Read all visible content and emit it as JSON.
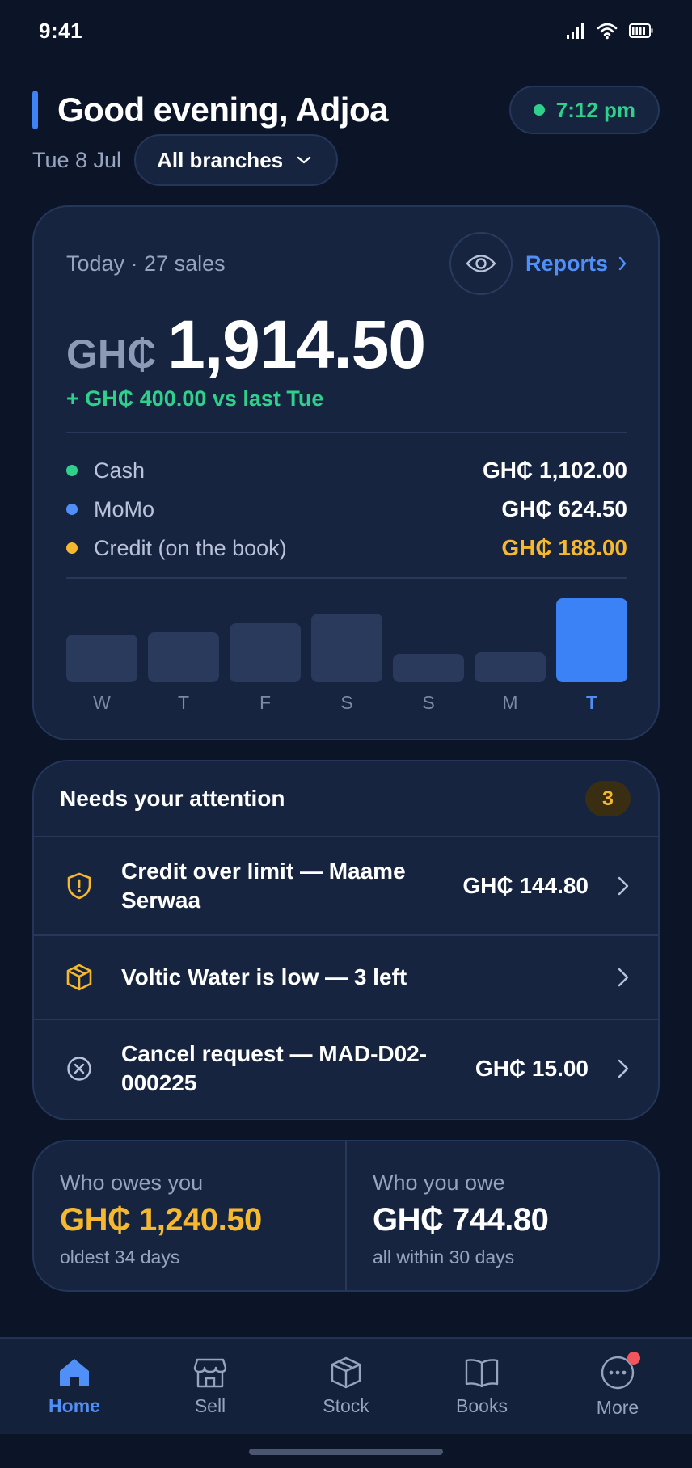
{
  "status_bar": {
    "time": "9:41"
  },
  "header": {
    "greeting": "Good evening, Adjoa",
    "time_pill": "7:12 pm",
    "date": "Tue 8 Jul",
    "branch_select": "All branches"
  },
  "sales": {
    "meta": "Today · 27 sales",
    "reports_label": "Reports",
    "currency": "GH₵",
    "amount": "1,914.50",
    "delta": "+ GH₵ 400.00 vs last Tue",
    "breakdown": [
      {
        "label": "Cash",
        "value": "GH₵ 1,102.00",
        "color": "#2fd08b"
      },
      {
        "label": "MoMo",
        "value": "GH₵ 624.50",
        "color": "#4f8ff7"
      },
      {
        "label": "Credit (on the book)",
        "value": "GH₵ 188.00",
        "color": "#f5b82e"
      }
    ]
  },
  "chart_data": {
    "type": "bar",
    "categories": [
      "W",
      "T",
      "F",
      "S",
      "S",
      "M",
      "T"
    ],
    "values": [
      0.57,
      0.6,
      0.7,
      0.82,
      0.34,
      0.36,
      1.0
    ],
    "highlight_index": 6,
    "colors": {
      "bar": "#2a3a5c",
      "highlight": "#3b82f6"
    }
  },
  "attention": {
    "title": "Needs your attention",
    "count": "3",
    "items": [
      {
        "text": "Credit over limit — Maame Serwaa",
        "amount": "GH₵ 144.80",
        "icon": "shield-alert-icon"
      },
      {
        "text": "Voltic Water is low — 3 left",
        "amount": "",
        "icon": "box-icon"
      },
      {
        "text": "Cancel request — MAD-D02-000225",
        "amount": "GH₵ 15.00",
        "icon": "x-circle-icon"
      }
    ]
  },
  "owe": {
    "owed_label": "Who owes you",
    "owed_value": "GH₵ 1,240.50",
    "owed_sub": "oldest 34 days",
    "you_owe_label": "Who you owe",
    "you_owe_value": "GH₵ 744.80",
    "you_owe_sub": "all within 30 days"
  },
  "tabs": [
    {
      "label": "Home",
      "icon": "home-icon"
    },
    {
      "label": "Sell",
      "icon": "store-icon"
    },
    {
      "label": "Stock",
      "icon": "box-icon"
    },
    {
      "label": "Books",
      "icon": "book-icon"
    },
    {
      "label": "More",
      "icon": "more-icon"
    }
  ]
}
